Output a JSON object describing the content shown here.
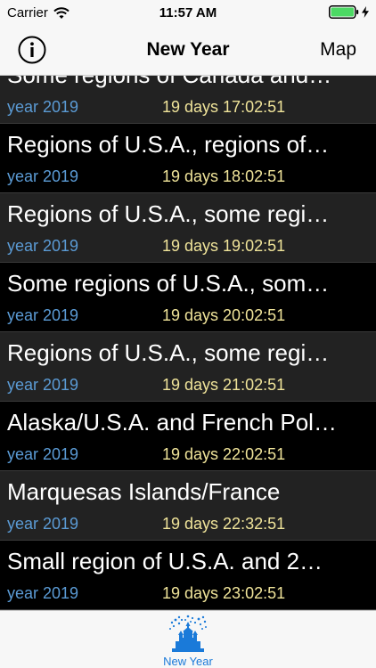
{
  "status_bar": {
    "carrier": "Carrier",
    "time": "11:57 AM"
  },
  "nav": {
    "title": "New Year",
    "right_button": "Map",
    "left_icon": "info-icon"
  },
  "rows": [
    {
      "title": "Some regions of Canada and…",
      "year": "year 2019",
      "countdown": "19 days 17:02:51"
    },
    {
      "title": "Regions of U.S.A., regions of…",
      "year": "year 2019",
      "countdown": "19 days 18:02:51"
    },
    {
      "title": "Regions of U.S.A., some regi…",
      "year": "year 2019",
      "countdown": "19 days 19:02:51"
    },
    {
      "title": "Some regions of U.S.A., som…",
      "year": "year 2019",
      "countdown": "19 days 20:02:51"
    },
    {
      "title": "Regions of U.S.A., some regi…",
      "year": "year 2019",
      "countdown": "19 days 21:02:51"
    },
    {
      "title": "Alaska/U.S.A. and French Pol…",
      "year": "year 2019",
      "countdown": "19 days 22:02:51"
    },
    {
      "title": "Marquesas Islands/France",
      "year": "year 2019",
      "countdown": "19 days 22:32:51"
    },
    {
      "title": "Small region of U.S.A. and 2…",
      "year": "year 2019",
      "countdown": "19 days 23:02:51"
    }
  ],
  "tab_bar": {
    "items": [
      {
        "label": "New Year",
        "icon": "fireworks-castle-icon"
      }
    ]
  },
  "colors": {
    "year_text": "#5b9bd5",
    "countdown_text": "#f0e49a",
    "tab_accent": "#1a7ad9"
  }
}
